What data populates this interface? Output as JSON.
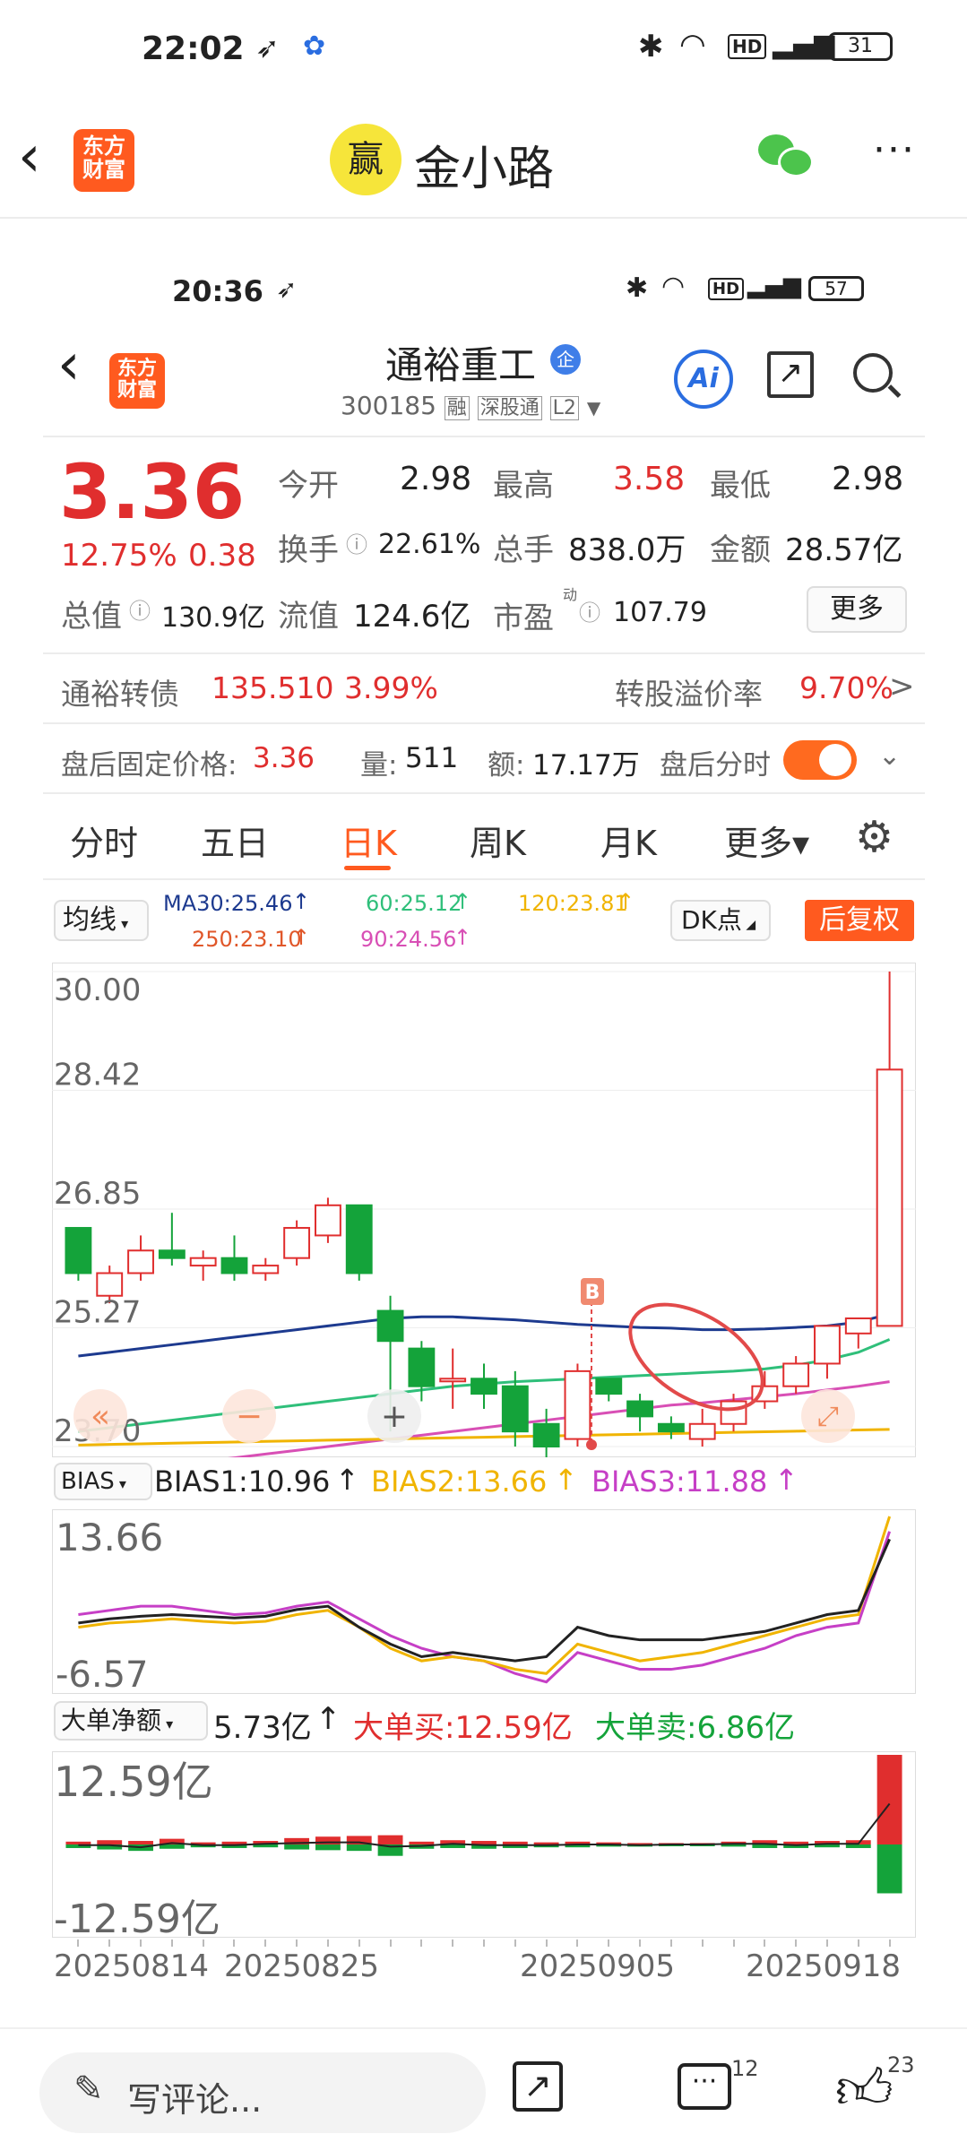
{
  "outer_status": {
    "time": "22:02",
    "battery": "31"
  },
  "outer_header": {
    "logo_line1": "东方",
    "logo_line2": "财富",
    "title": "金小路",
    "avatar_text": "赢"
  },
  "inner_status": {
    "time": "20:36",
    "battery": "57"
  },
  "stock_header": {
    "name": "通裕重工",
    "badge": "企",
    "code": "300185",
    "tag1": "融",
    "tag2": "深股通",
    "tag3": "L2",
    "ai": "Ai"
  },
  "quote": {
    "price": "3.36",
    "change_pct": "12.75%",
    "change": "0.38",
    "open_label": "今开",
    "open": "2.98",
    "high_label": "最高",
    "high": "3.58",
    "low_label": "最低",
    "low": "2.98",
    "turnover_label": "换手",
    "turnover": "22.61%",
    "volume_label": "总手",
    "volume": "838.0万",
    "amount_label": "金额",
    "amount": "28.57亿",
    "mktcap_label": "总值",
    "mktcap": "130.9亿",
    "float_label": "流值",
    "float": "124.6亿",
    "pe_label": "市盈",
    "pe_sup": "动",
    "pe": "107.79",
    "more": "更多"
  },
  "bond": {
    "name": "通裕转债",
    "price": "135.510",
    "pct": "3.99%",
    "premium_label": "转股溢价率",
    "premium": "9.70%",
    "arrow": ">"
  },
  "after_hours": {
    "price_label": "盘后固定价格:",
    "price": "3.36",
    "vol_label": "量:",
    "vol": "511",
    "amt_label": "额:",
    "amt": "17.17万",
    "timeline": "盘后分时"
  },
  "tabs": [
    "分时",
    "五日",
    "日K",
    "周K",
    "月K",
    "更多▾"
  ],
  "ma_bar": {
    "select": "均线",
    "ma30": "MA30:25.46",
    "ma60": "60:25.12",
    "ma120": "120:23.81",
    "ma250": "250:23.10",
    "ma90": "90:24.56",
    "dk": "DK点",
    "fq": "后复权"
  },
  "kline": {
    "y_labels": [
      "30.00",
      "28.42",
      "26.85",
      "25.27",
      "23.70"
    ],
    "buy_marker": "B",
    "nav_left": "«",
    "nav_minus": "−",
    "nav_plus": "+"
  },
  "bias": {
    "select": "BIAS",
    "b1": "BIAS1:10.96",
    "b2": "BIAS2:13.66",
    "b3": "BIAS3:11.88",
    "y_top": "13.66",
    "y_bot": "-6.57"
  },
  "bigorder": {
    "select": "大单净额",
    "net": "5.73亿",
    "buy": "大单买:12.59亿",
    "sell": "大单卖:6.86亿",
    "y_top": "12.59亿",
    "y_bot": "-12.59亿"
  },
  "dates": [
    "20250814",
    "20250825",
    "20250905",
    "20250918"
  ],
  "bottom_bar": {
    "comment_placeholder": "写评论...",
    "comment_count": "12",
    "like_count": "23"
  },
  "colors": {
    "up": "#e02e2e",
    "down": "#14a33a",
    "accent": "#ff5a1f",
    "ma30": "#1d3a8f",
    "ma60": "#2fbf7a",
    "ma90": "#d84fb5",
    "ma120": "#f0b400",
    "ma250": "#e0572a"
  },
  "chart_data": {
    "type": "candlestick",
    "y_range": [
      23.7,
      30.0
    ],
    "candles": [
      {
        "o": 26.6,
        "c": 26.0,
        "h": 26.6,
        "l": 25.9
      },
      {
        "o": 25.7,
        "c": 26.0,
        "h": 26.1,
        "l": 25.6
      },
      {
        "o": 26.0,
        "c": 26.3,
        "h": 26.5,
        "l": 25.9
      },
      {
        "o": 26.3,
        "c": 26.2,
        "h": 26.8,
        "l": 26.1
      },
      {
        "o": 26.1,
        "c": 26.2,
        "h": 26.3,
        "l": 25.9
      },
      {
        "o": 26.2,
        "c": 26.0,
        "h": 26.5,
        "l": 25.9
      },
      {
        "o": 26.0,
        "c": 26.1,
        "h": 26.2,
        "l": 25.9
      },
      {
        "o": 26.2,
        "c": 26.6,
        "h": 26.7,
        "l": 26.1
      },
      {
        "o": 26.5,
        "c": 26.9,
        "h": 27.0,
        "l": 26.4
      },
      {
        "o": 26.9,
        "c": 26.0,
        "h": 26.9,
        "l": 25.9
      },
      {
        "o": 25.5,
        "c": 25.1,
        "h": 25.7,
        "l": 23.9
      },
      {
        "o": 25.0,
        "c": 24.5,
        "h": 25.1,
        "l": 24.3
      },
      {
        "o": 24.6,
        "c": 24.6,
        "h": 25.0,
        "l": 24.2
      },
      {
        "o": 24.6,
        "c": 24.4,
        "h": 24.8,
        "l": 24.2
      },
      {
        "o": 24.5,
        "c": 23.9,
        "h": 24.7,
        "l": 23.7
      },
      {
        "o": 24.0,
        "c": 23.7,
        "h": 24.2,
        "l": 23.4
      },
      {
        "o": 23.8,
        "c": 24.7,
        "h": 24.8,
        "l": 23.7
      },
      {
        "o": 24.6,
        "c": 24.4,
        "h": 24.6,
        "l": 24.3
      },
      {
        "o": 24.3,
        "c": 24.1,
        "h": 24.4,
        "l": 23.9
      },
      {
        "o": 24.0,
        "c": 23.9,
        "h": 24.1,
        "l": 23.8
      },
      {
        "o": 23.8,
        "c": 24.0,
        "h": 24.2,
        "l": 23.7
      },
      {
        "o": 24.0,
        "c": 24.3,
        "h": 24.4,
        "l": 23.9
      },
      {
        "o": 24.3,
        "c": 24.5,
        "h": 24.7,
        "l": 24.2
      },
      {
        "o": 24.5,
        "c": 24.8,
        "h": 24.9,
        "l": 24.4
      },
      {
        "o": 24.8,
        "c": 25.3,
        "h": 25.3,
        "l": 24.6
      },
      {
        "o": 25.2,
        "c": 25.4,
        "h": 25.4,
        "l": 25.0
      },
      {
        "o": 25.3,
        "c": 28.7,
        "h": 30.0,
        "l": 25.3
      }
    ],
    "ma30": [
      24.9,
      24.95,
      25.0,
      25.05,
      25.1,
      25.15,
      25.2,
      25.25,
      25.3,
      25.35,
      25.4,
      25.42,
      25.42,
      25.4,
      25.38,
      25.35,
      25.32,
      25.3,
      25.28,
      25.27,
      25.25,
      25.25,
      25.26,
      25.28,
      25.3,
      25.35,
      25.46
    ],
    "ma60": [
      23.9,
      23.95,
      24.0,
      24.05,
      24.1,
      24.15,
      24.2,
      24.25,
      24.3,
      24.35,
      24.4,
      24.45,
      24.5,
      24.53,
      24.56,
      24.58,
      24.6,
      24.62,
      24.64,
      24.66,
      24.68,
      24.7,
      24.73,
      24.78,
      24.85,
      24.95,
      25.12
    ],
    "ma90": [
      23.3,
      23.35,
      23.4,
      23.45,
      23.5,
      23.55,
      23.6,
      23.65,
      23.7,
      23.75,
      23.8,
      23.85,
      23.9,
      23.95,
      24.0,
      24.05,
      24.1,
      24.15,
      24.2,
      24.25,
      24.28,
      24.32,
      24.36,
      24.4,
      24.45,
      24.5,
      24.56
    ],
    "bias": {
      "y_range": [
        -6.57,
        13.66
      ],
      "b1": [
        1.0,
        1.5,
        1.8,
        2.0,
        1.8,
        1.6,
        1.8,
        2.6,
        3.0,
        0.5,
        -1.5,
        -3.0,
        -2.5,
        -3.0,
        -3.5,
        -3.0,
        0.5,
        -0.5,
        -1.0,
        -1.0,
        -1.0,
        -0.5,
        0.0,
        1.0,
        2.0,
        2.5,
        10.96
      ],
      "b2": [
        0.5,
        1.0,
        1.2,
        1.5,
        1.2,
        1.0,
        1.2,
        2.0,
        2.5,
        0.5,
        -2.0,
        -3.5,
        -3.0,
        -3.5,
        -4.5,
        -5.0,
        -1.5,
        -2.5,
        -3.5,
        -3.0,
        -2.5,
        -1.5,
        -0.5,
        0.5,
        1.5,
        2.0,
        13.66
      ],
      "b3": [
        2.0,
        2.5,
        3.0,
        3.0,
        2.5,
        2.0,
        2.2,
        3.0,
        3.5,
        1.5,
        -0.5,
        -2.0,
        -3.0,
        -3.5,
        -5.0,
        -6.0,
        -2.5,
        -3.5,
        -4.5,
        -4.5,
        -4.0,
        -3.0,
        -2.0,
        -0.5,
        0.5,
        1.0,
        11.88
      ]
    },
    "bigorder": {
      "y_range": [
        -12.59,
        12.59
      ],
      "buy": [
        0.4,
        0.6,
        0.5,
        0.8,
        0.3,
        0.4,
        0.5,
        0.9,
        1.1,
        1.2,
        1.3,
        0.4,
        0.6,
        0.5,
        0.4,
        0.3,
        0.4,
        0.3,
        0.2,
        0.2,
        0.2,
        0.4,
        0.6,
        0.4,
        0.5,
        0.6,
        12.59
      ],
      "sell": [
        0.5,
        0.7,
        0.9,
        0.6,
        0.4,
        0.5,
        0.4,
        0.7,
        0.8,
        0.9,
        1.6,
        0.6,
        0.5,
        0.6,
        0.5,
        0.4,
        0.4,
        0.3,
        0.3,
        0.2,
        0.2,
        0.3,
        0.5,
        0.5,
        0.4,
        0.5,
        6.86
      ]
    }
  }
}
